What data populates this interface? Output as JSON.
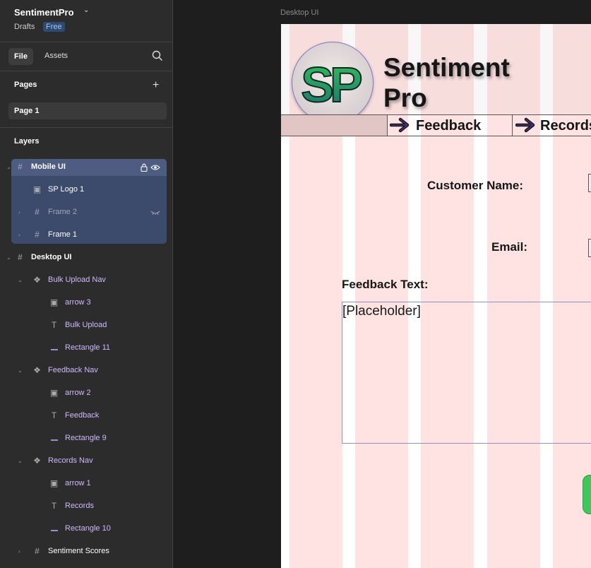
{
  "project": {
    "name": "SentimentPro",
    "folder": "Drafts",
    "plan": "Free"
  },
  "tabs": {
    "file": "File",
    "assets": "Assets"
  },
  "pages": {
    "title": "Pages",
    "items": [
      "Page 1"
    ]
  },
  "layers": {
    "title": "Layers",
    "items": [
      {
        "name": "Mobile UI",
        "icon": "frame-icon",
        "indent": 0,
        "expanded": true,
        "selected": true,
        "bold": true,
        "locked": true,
        "visible": true
      },
      {
        "name": "SP Logo 1",
        "icon": "image-icon",
        "indent": 1,
        "selected": true
      },
      {
        "name": "Frame 2",
        "icon": "frame-icon",
        "indent": 1,
        "collapsed": true,
        "selected": true,
        "hidden": true
      },
      {
        "name": "Frame 1",
        "icon": "frame-icon",
        "indent": 1,
        "collapsed": true,
        "selected": true
      },
      {
        "name": "Desktop UI",
        "icon": "frame-icon",
        "indent": 0,
        "expanded": true,
        "bold": true
      },
      {
        "name": "Bulk Upload Nav",
        "icon": "component-icon",
        "indent": 1,
        "expanded": true
      },
      {
        "name": "arrow 3",
        "icon": "image-icon",
        "indent": 2
      },
      {
        "name": "Bulk Upload",
        "icon": "text-icon",
        "indent": 2
      },
      {
        "name": "Rectangle 11",
        "icon": "rectangle-icon",
        "indent": 2
      },
      {
        "name": "Feedback Nav",
        "icon": "component-icon",
        "indent": 1,
        "expanded": true
      },
      {
        "name": "arrow 2",
        "icon": "image-icon",
        "indent": 2
      },
      {
        "name": "Feedback",
        "icon": "text-icon",
        "indent": 2
      },
      {
        "name": "Rectangle 9",
        "icon": "rectangle-icon",
        "indent": 2
      },
      {
        "name": "Records Nav",
        "icon": "component-icon",
        "indent": 1,
        "expanded": true
      },
      {
        "name": "arrow 1",
        "icon": "image-icon",
        "indent": 2
      },
      {
        "name": "Records",
        "icon": "text-icon",
        "indent": 2
      },
      {
        "name": "Rectangle 10",
        "icon": "rectangle-icon",
        "indent": 2
      },
      {
        "name": "Sentiment Scores",
        "icon": "frame-icon",
        "indent": 1,
        "collapsed": true
      }
    ]
  },
  "canvas": {
    "frame_label": "Desktop UI",
    "logo_text": "SP",
    "brand_line1": "Sentiment",
    "brand_line2": "Pro",
    "nav": {
      "feedback": "Feedback",
      "records": "Records"
    },
    "form": {
      "customer_name_label": "Customer Name:",
      "email_label": "Email:",
      "feedback_text_label": "Feedback Text:",
      "feedback_placeholder": "[Placeholder]"
    },
    "colors": {
      "layout_grid": "#ffe3e3",
      "button_green": "#3ec75b",
      "selection": "#3c4a6b"
    }
  }
}
